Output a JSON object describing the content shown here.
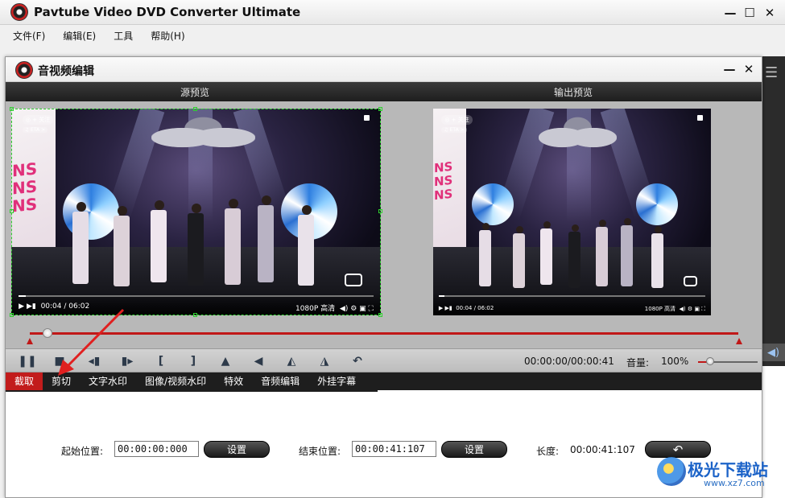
{
  "app": {
    "title": "Pavtube Video DVD Converter Ultimate",
    "menu": [
      "文件(F)",
      "编辑(E)",
      "工具",
      "帮助(H)"
    ]
  },
  "dialog": {
    "title": "音视频编辑",
    "source_preview_label": "源预览",
    "output_preview_label": "输出预览",
    "video_overlay": {
      "tag": "◎ + 关注",
      "tag2": "♫ ETA >",
      "time": "00:04 / 06:02",
      "quality": "1080P 高清"
    }
  },
  "timeline": {
    "position_fraction": 0.018
  },
  "controls": {
    "buttons": [
      {
        "name": "pause-icon",
        "glyph": "❚❚"
      },
      {
        "name": "stop-icon",
        "glyph": "■"
      },
      {
        "name": "prev-frame-icon",
        "glyph": "◂▮"
      },
      {
        "name": "next-frame-icon",
        "glyph": "▮▸"
      },
      {
        "name": "set-start-icon",
        "glyph": "["
      },
      {
        "name": "set-end-icon",
        "glyph": "]"
      },
      {
        "name": "flip-vertical-icon",
        "glyph": "▲"
      },
      {
        "name": "flip-horizontal-icon",
        "glyph": "◀"
      },
      {
        "name": "rotate-left-icon",
        "glyph": "◭"
      },
      {
        "name": "rotate-right-icon",
        "glyph": "◮"
      },
      {
        "name": "undo-icon",
        "glyph": "↶"
      }
    ],
    "time": "00:00:00/00:00:41",
    "volume_label": "音量:",
    "volume_value": "100%",
    "volume_fraction": 0.2
  },
  "tabs": [
    "截取",
    "剪切",
    "文字水印",
    "图像/视频水印",
    "特效",
    "音频编辑",
    "外挂字幕"
  ],
  "active_tab": 0,
  "trim": {
    "start_label": "起始位置:",
    "start_value": "00:00:00:000",
    "start_set": "设置",
    "end_label": "结束位置:",
    "end_value": "00:00:41:107",
    "end_set": "设置",
    "length_label": "长度:",
    "length_value": "00:00:41:107",
    "reset_icon": "↶"
  },
  "watermark": {
    "text": "极光下载站",
    "url": "www.xz7.com"
  },
  "colors": {
    "accent_red": "#c21c1c",
    "crop_green": "#2fd12f",
    "dark_bar": "#1e1e1e"
  }
}
